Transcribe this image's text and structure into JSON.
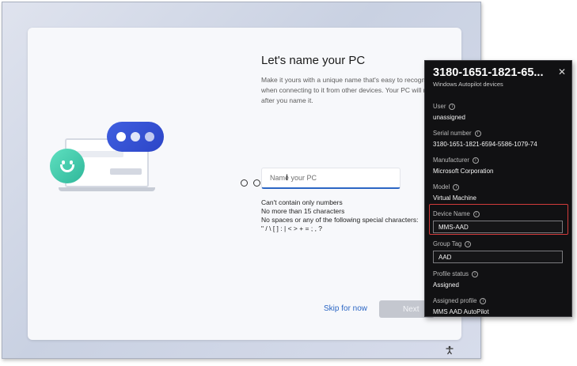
{
  "oobe": {
    "title": "Let's name your PC",
    "description": "Make it yours with a unique name that's easy to recogni\nwhen connecting to it from other devices. Your PC will r\nafter you name it.",
    "input_placeholder": "Name your PC",
    "rules": [
      "Can't contain only numbers",
      "No more than 15 characters",
      "No spaces or any of the following special characters:",
      "\" / \\ [ ] : | < > + = ; , ?"
    ],
    "skip_label": "Skip for now",
    "next_label": "Next",
    "accent": "#2b66c4"
  },
  "panel": {
    "title": "3180-1651-1821-65...",
    "subtitle": "Windows Autopilot devices",
    "close_label": "✕",
    "fields": {
      "user": {
        "label": "User",
        "value": "unassigned"
      },
      "serial": {
        "label": "Serial number",
        "value": "3180-1651-1821-6594-5586-1079-74"
      },
      "manufacturer": {
        "label": "Manufacturer",
        "value": "Microsoft Corporation"
      },
      "model": {
        "label": "Model",
        "value": "Virtual Machine"
      },
      "device_name": {
        "label": "Device Name",
        "value": "MMS-AAD"
      },
      "group_tag": {
        "label": "Group Tag",
        "value": "AAD"
      },
      "profile_status": {
        "label": "Profile status",
        "value": "Assigned"
      },
      "assigned_profile": {
        "label": "Assigned profile",
        "value": "MMS AAD AutoPilot"
      }
    },
    "highlight_color": "#d23b3b"
  }
}
